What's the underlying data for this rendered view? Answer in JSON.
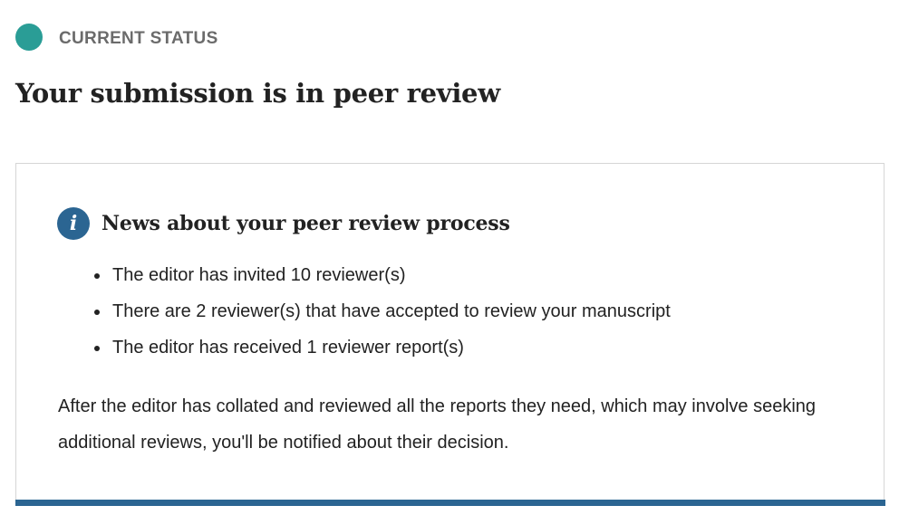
{
  "status": {
    "label": "CURRENT STATUS",
    "dot_color": "#2a9d96"
  },
  "page": {
    "title": "Your submission is in peer review"
  },
  "news": {
    "icon": "info-icon",
    "icon_glyph": "i",
    "icon_color": "#2b6592",
    "heading": "News about your peer review process",
    "items": [
      "The editor has invited 10 reviewer(s)",
      "There are 2 reviewer(s) that have accepted to review your manuscript",
      "The editor has received 1 reviewer report(s)"
    ],
    "footnote": "After the editor has collated and reviewed all the reports they need, which may involve seeking additional reviews, you'll be notified about their decision.",
    "accent_bar_color": "#2b6592"
  }
}
